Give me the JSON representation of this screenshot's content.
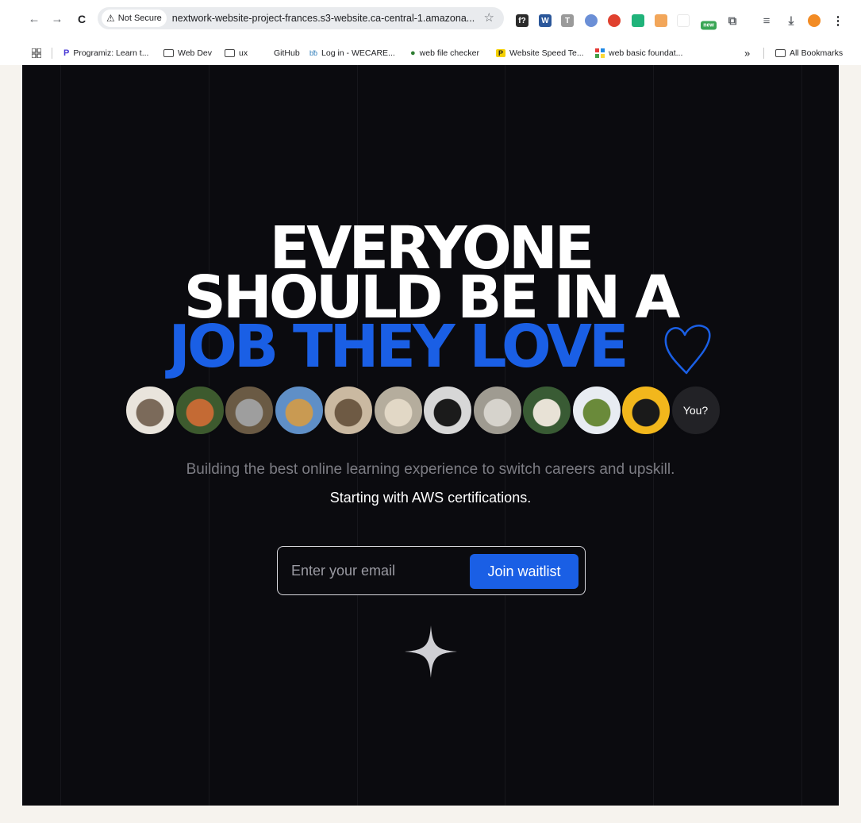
{
  "browser": {
    "nav": {
      "back": "←",
      "forward": "→",
      "reload": "C"
    },
    "security_label": "Not Secure",
    "url": "nextwork-website-project-frances.s3-website.ca-central-1.amazona...",
    "extensions": [
      {
        "name": "formula-ext-icon",
        "glyph": "f?",
        "color": "#2b2b2b"
      },
      {
        "name": "word-ext-icon",
        "glyph": "W",
        "color": "#2b579a"
      },
      {
        "name": "text-ext-icon",
        "glyph": "T",
        "color": "#9a9a9a"
      },
      {
        "name": "blue-circle-ext-icon",
        "glyph": "",
        "color": "#6b8fd6"
      },
      {
        "name": "color-wheel-ext-icon",
        "glyph": "",
        "color": "#e0412f"
      },
      {
        "name": "green-ext-icon",
        "glyph": "",
        "color": "#20b37a"
      },
      {
        "name": "orange-square-ext-icon",
        "glyph": "",
        "color": "#f2a65a"
      },
      {
        "name": "blank-ext-icon",
        "glyph": "",
        "color": "#e8e8e8"
      },
      {
        "name": "new-badge-ext-icon",
        "glyph": "new",
        "color": "#3aa655"
      },
      {
        "name": "extensions-puzzle-icon",
        "glyph": "⧉",
        "color": "#5f6368"
      },
      {
        "name": "reading-list-icon",
        "glyph": "≡",
        "color": "#5f6368"
      },
      {
        "name": "download-icon",
        "glyph": "⤓",
        "color": "#5f6368"
      },
      {
        "name": "profile-avatar-icon",
        "glyph": "",
        "color": "#f28b24"
      },
      {
        "name": "menu-dots-icon",
        "glyph": "⋮",
        "color": "#202124"
      }
    ],
    "bookmarks": {
      "programiz": "Programiz: Learn t...",
      "webdev": "Web Dev",
      "ux": "ux",
      "github": "GitHub",
      "wecare": "Log in - WECARE...",
      "checker": "web file checker",
      "speed": "Website Speed Te...",
      "basic": "web basic foundat...",
      "more": "»",
      "all": "All Bookmarks"
    }
  },
  "hero": {
    "line1": "EVERYONE",
    "line2": "SHOULD BE IN A",
    "line3": "JOB THEY LOVE",
    "avatars": [
      {
        "name": "avatar-fluffy-dog",
        "bg": "#e9e4dc",
        "fg": "#7b6a5a"
      },
      {
        "name": "avatar-red-squirrel",
        "bg": "#3d5a2e",
        "fg": "#c46a34"
      },
      {
        "name": "avatar-koala",
        "bg": "#6a5a44",
        "fg": "#9e9e9e"
      },
      {
        "name": "avatar-giraffe",
        "bg": "#5f8fc7",
        "fg": "#c99a52"
      },
      {
        "name": "avatar-yawning-cat",
        "bg": "#cab9a1",
        "fg": "#6e5a44"
      },
      {
        "name": "avatar-blanket-dog",
        "bg": "#b5ad9d",
        "fg": "#e2d8c6"
      },
      {
        "name": "avatar-black-pug",
        "bg": "#d7d7d7",
        "fg": "#1b1b1b"
      },
      {
        "name": "avatar-seal",
        "bg": "#9f9b91",
        "fg": "#d6d3cc"
      },
      {
        "name": "avatar-alpaca",
        "bg": "#395b34",
        "fg": "#e8e2d6"
      },
      {
        "name": "avatar-pineapple",
        "bg": "#e8ecf2",
        "fg": "#6a8a3a"
      },
      {
        "name": "avatar-pug-on-yellow",
        "bg": "#f2b71c",
        "fg": "#1a1a1a"
      }
    ],
    "you_label": "You?"
  },
  "subtitle": "Building the best online learning experience to switch careers and upskill.",
  "tagline": "Starting with AWS certifications.",
  "form": {
    "placeholder": "Enter your email",
    "button": "Join waitlist"
  },
  "colors": {
    "accent": "#1a5fe5",
    "background": "#0b0b0f"
  }
}
